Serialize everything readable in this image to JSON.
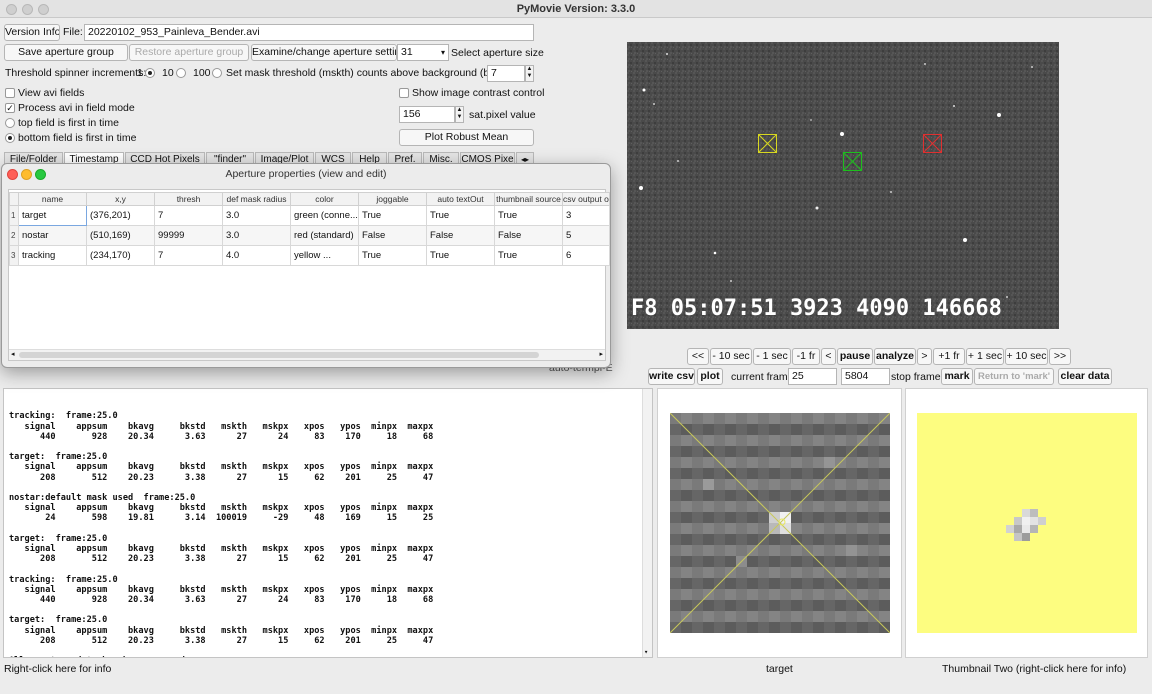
{
  "window": {
    "title": "PyMovie  Version: 3.3.0"
  },
  "top": {
    "version_button": "Version Info",
    "file_label": "File:",
    "file_value": "20220102_953_Painleva_Bender.avi",
    "save_group": "Save aperture group",
    "restore_group": "Restore aperture group",
    "examine_settings": "Examine/change aperture settings",
    "aperture_size_value": "31",
    "aperture_size_label": "Select aperture size",
    "threshold_label": "Threshold spinner increments:",
    "inc_options": [
      "1",
      "10",
      "100"
    ],
    "mask_label": "Set mask threshold (mskth) counts above background (bkavg)",
    "mask_value": "7",
    "view_fields": "View avi fields",
    "process_fields": "Process avi in field mode",
    "top_field": "top field is first in time",
    "bottom_field": "bottom field is first in time",
    "contrast_control": "Show image contrast control",
    "sat_value": "156",
    "sat_label": "sat.pixel value",
    "robust_mean": "Plot Robust Mean"
  },
  "tabs": [
    "File/Folder",
    "Timestamp",
    "CCD Hot Pixels",
    "\"finder\"",
    "Image/Plot",
    "WCS",
    "Help",
    "Pref.",
    "Misc.",
    "CMOS Pixe"
  ],
  "dialog": {
    "title": "Aperture properties (view and edit)",
    "columns": [
      "name",
      "x,y",
      "thresh",
      "def mask radius",
      "color",
      "joggable",
      "auto textOut",
      "thumbnail source",
      "csv output o"
    ],
    "rows": [
      {
        "num": "1",
        "cells": [
          "target",
          "(376,201)",
          "7",
          "3.0",
          "green (conne...",
          "True",
          "True",
          "True",
          "3"
        ]
      },
      {
        "num": "2",
        "cells": [
          "nostar",
          "(510,169)",
          "99999",
          "3.0",
          "red (standard)",
          "False",
          "False",
          "False",
          "5"
        ]
      },
      {
        "num": "3",
        "cells": [
          "tracking",
          "(234,170)",
          "7",
          "4.0",
          "yellow ...",
          "True",
          "True",
          "True",
          "6"
        ]
      }
    ]
  },
  "video": {
    "timestamp_overlay": "F8 05:07:51 3923 4090 146668",
    "colors": {
      "target": "#1dbf1d",
      "nostar": "#e03030",
      "tracking": "#d8d820"
    }
  },
  "playback": {
    "buttons": [
      "<<",
      "- 10 sec",
      "- 1 sec",
      "-1 fr",
      "<",
      "pause",
      "analyze",
      ">",
      "+1 fr",
      "+ 1 sec",
      "+ 10 sec",
      ">>"
    ]
  },
  "frame_controls": {
    "write_csv": "write csv",
    "plot": "plot",
    "current_frame_label": "current frame",
    "current_frame": "25",
    "stop_frame_value": "5804",
    "stop_frame_label": "stop frame",
    "mark": "mark",
    "return_mark": "Return to 'mark'",
    "clear_data": "clear data"
  },
  "hidden_label": "auto-termpl-E",
  "text_output": "tracking:  frame:25.0\n   signal    appsum    bkavg     bkstd   mskth   mskpx   xpos   ypos  minpx  maxpx\n      440       928    20.34      3.63      27      24     83    170     18     68\n\ntarget:  frame:25.0\n   signal    appsum    bkavg     bkstd   mskth   mskpx   xpos   ypos  minpx  maxpx\n      208       512    20.23      3.38      27      15     62    201     25     47\n\nnostar:default mask used  frame:25.0\n   signal    appsum    bkavg     bkstd   mskth   mskpx   xpos   ypos  minpx  maxpx\n       24       598    19.81      3.14  100019     -29     48    169     15     25\n\ntarget:  frame:25.0\n   signal    appsum    bkavg     bkstd   mskth   mskpx   xpos   ypos  minpx  maxpx\n      208       512    20.23      3.38      27      15     62    201     25     47\n\ntracking:  frame:25.0\n   signal    appsum    bkavg     bkstd   mskth   mskpx   xpos   ypos  minpx  maxpx\n      440       928    20.34      3.63      27      24     83    170     18     68\n\ntarget:  frame:25.0\n   signal    appsum    bkavg     bkstd   mskth   mskpx   xpos   ypos  minpx  maxpx\n      208       512    20.23      3.38      27      15     62    201     25     47\n\nAll aperture data has been removed.",
  "status": {
    "left": "Right-click here for info",
    "center": "target",
    "right": "Thumbnail Two (right-click here for info)"
  },
  "thumbnail_two_color": "#fdfd80"
}
